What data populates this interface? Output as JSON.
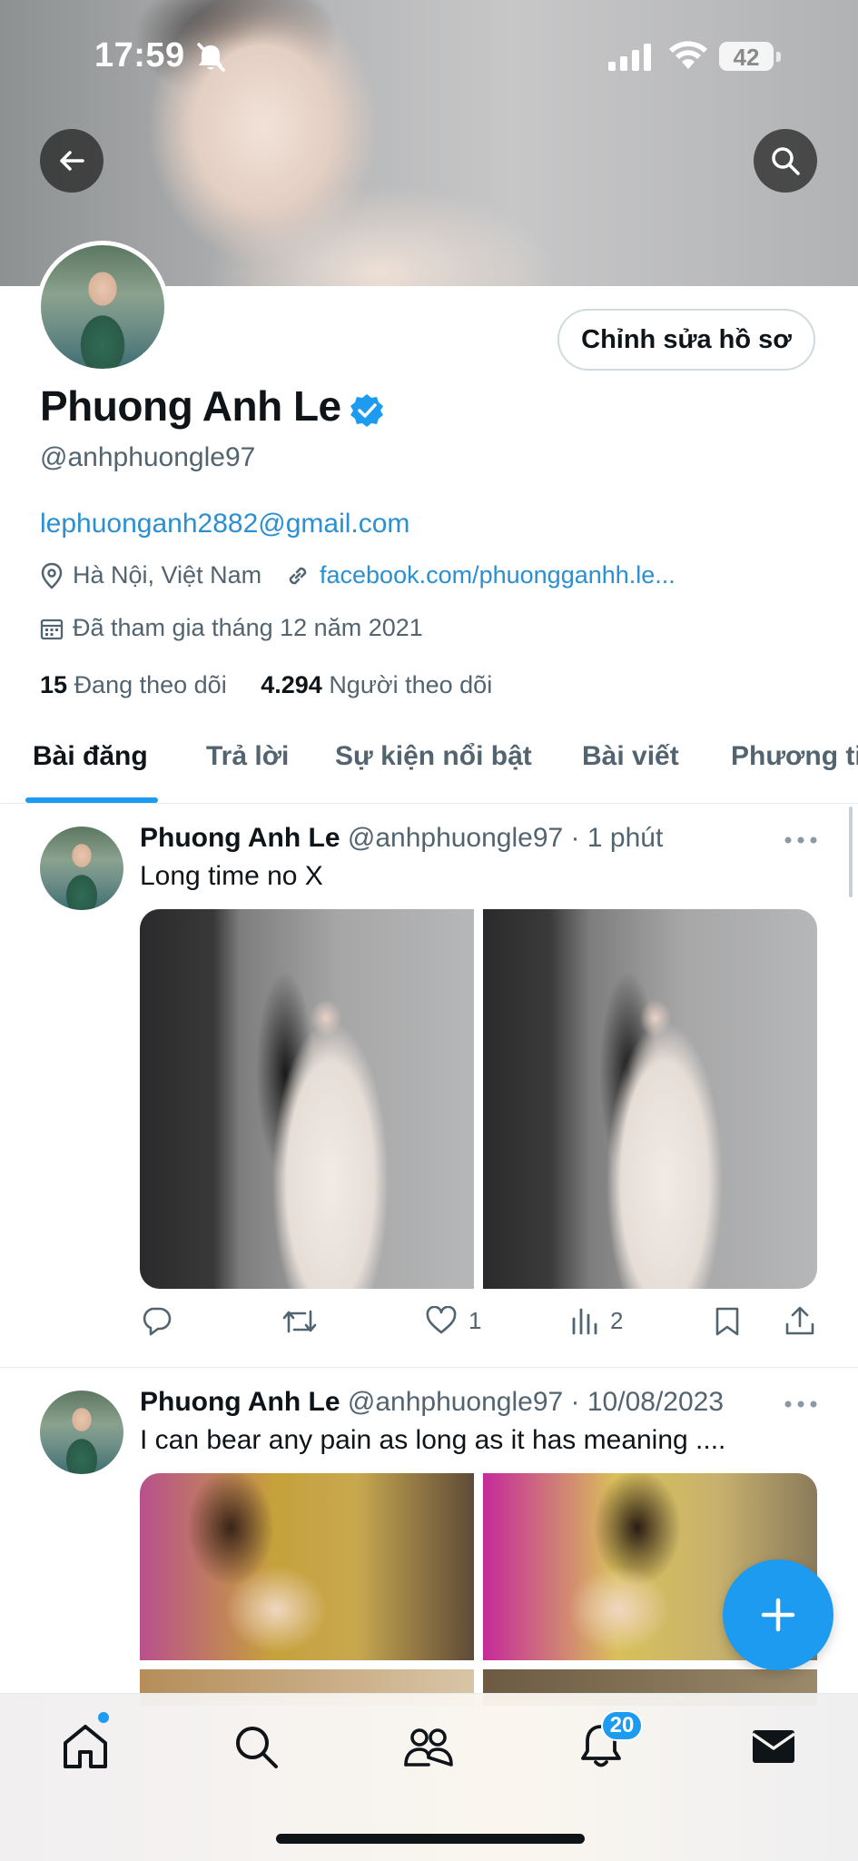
{
  "status_bar": {
    "time": "17:59",
    "battery": "42"
  },
  "profile": {
    "name": "Phuong Anh Le",
    "handle": "@anhphuongle97",
    "email": "lephuonganh2882@gmail.com",
    "location": "Hà Nội, Việt Nam",
    "website": "facebook.com/phuongganhh.le...",
    "joined": "Đã tham gia tháng 12 năm 2021",
    "following_count": "15",
    "following_label": "Đang theo dõi",
    "followers_count": "4.294",
    "followers_label": "Người theo dõi",
    "edit_button": "Chỉnh sửa hồ sơ"
  },
  "tabs": [
    {
      "label": "Bài đăng",
      "active": true
    },
    {
      "label": "Trả lời"
    },
    {
      "label": "Sự kiện nổi bật"
    },
    {
      "label": "Bài viết"
    },
    {
      "label": "Phương ti"
    }
  ],
  "posts": [
    {
      "name": "Phuong Anh Le",
      "meta": "@anhphuongle97 · 1 phút",
      "text": "Long time no X",
      "likes": "1",
      "views": "2"
    },
    {
      "name": "Phuong Anh Le",
      "meta": "@anhphuongle97 · 10/08/2023",
      "text": "I can bear any pain as long as it has meaning ...."
    }
  ],
  "bottom_nav": {
    "notifications_badge": "20"
  },
  "colors": {
    "accent": "#1d9bf0",
    "text": "#0f1419",
    "muted": "#536471"
  }
}
